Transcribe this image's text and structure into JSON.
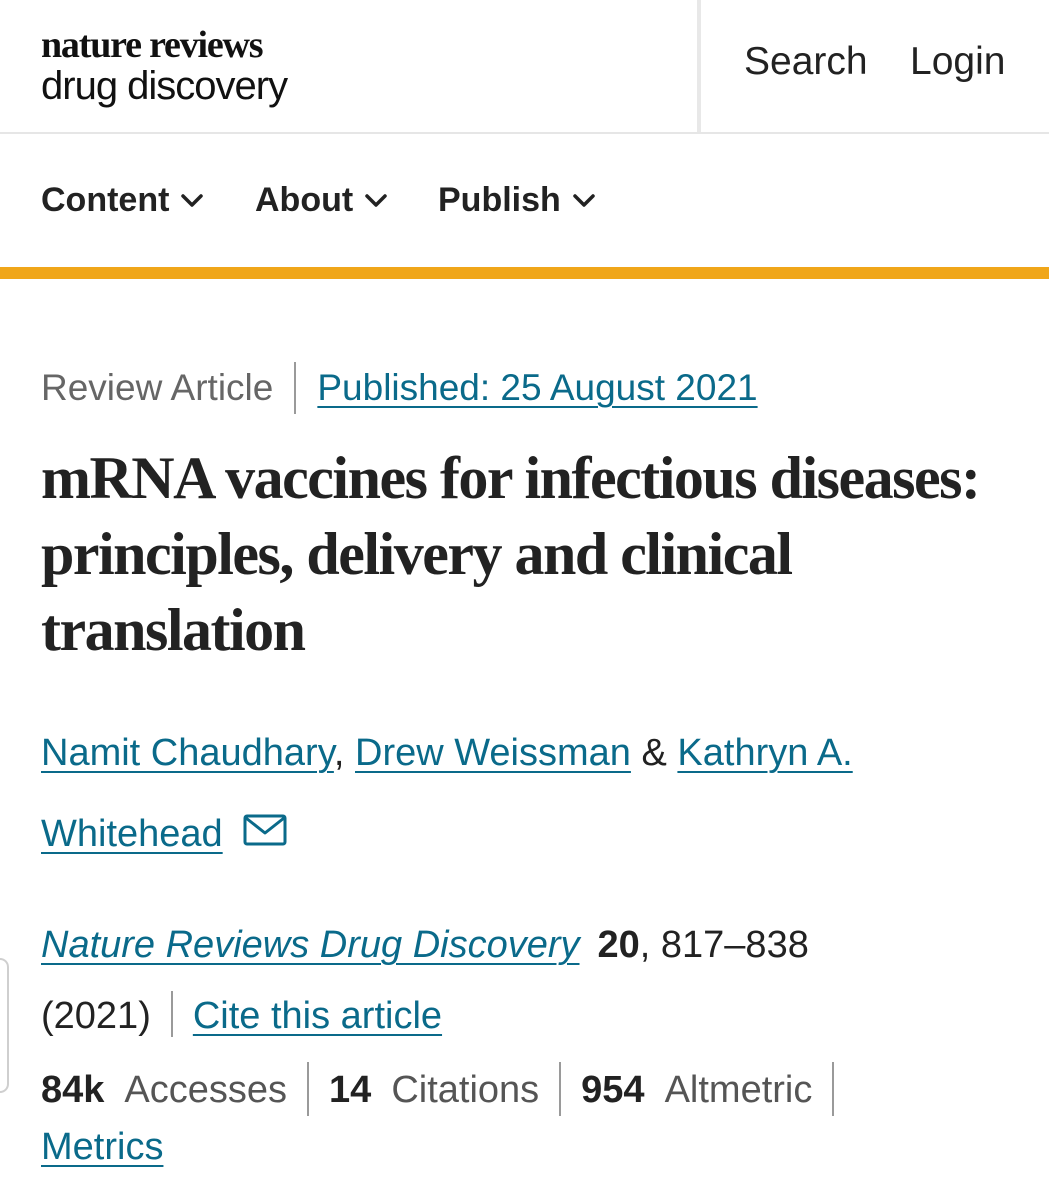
{
  "header": {
    "logo_line1": "nature reviews",
    "logo_line2": "drug discovery",
    "search_label": "Search",
    "login_label": "Login"
  },
  "nav": {
    "items": [
      {
        "label": "Content",
        "icon": "chevron-down-icon"
      },
      {
        "label": "About",
        "icon": "chevron-down-icon"
      },
      {
        "label": "Publish",
        "icon": "chevron-down-icon"
      }
    ]
  },
  "theme": {
    "accent": "#f0a619",
    "link": "#0a6a8a",
    "text": "#222222"
  },
  "article": {
    "type": "Review Article",
    "published": "Published: 25 August 2021",
    "title": "mRNA vaccines for infectious diseases: principles, delivery and clinical translation",
    "authors": [
      {
        "name": "Namit Chaudhary"
      },
      {
        "name": "Drew Weissman"
      },
      {
        "name": "Kathryn A. Whitehead"
      }
    ],
    "author_sep_comma": ",",
    "author_sep_amp": "&",
    "journal": "Nature Reviews Drug Discovery",
    "volume": "20",
    "pages": ", 817–838",
    "year": "(2021)",
    "cite_label": "Cite this article"
  },
  "metrics": {
    "accesses_count": "84k",
    "accesses_label": "Accesses",
    "citations_count": "14",
    "citations_label": "Citations",
    "altmetric_count": "954",
    "altmetric_label": "Altmetric",
    "metrics_link": "Metrics"
  }
}
